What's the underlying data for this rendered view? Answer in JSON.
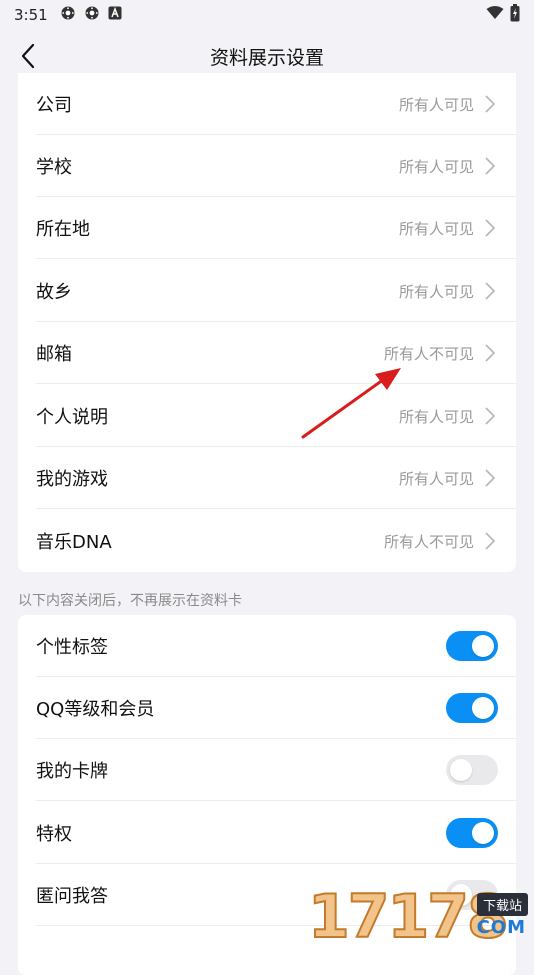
{
  "status_bar": {
    "time": "3:51",
    "icons": [
      "settings-gear-icon",
      "settings-gear-icon",
      "a-box-icon"
    ],
    "right_icons": [
      "wifi-icon",
      "battery-charging-icon"
    ]
  },
  "header": {
    "title": "资料展示设置",
    "back_icon": "chevron-left-icon"
  },
  "visibility_rows": [
    {
      "label": "公司",
      "value": "所有人可见"
    },
    {
      "label": "学校",
      "value": "所有人可见"
    },
    {
      "label": "所在地",
      "value": "所有人可见"
    },
    {
      "label": "故乡",
      "value": "所有人可见"
    },
    {
      "label": "邮箱",
      "value": "所有人不可见"
    },
    {
      "label": "个人说明",
      "value": "所有人可见"
    },
    {
      "label": "我的游戏",
      "value": "所有人可见"
    },
    {
      "label": "音乐DNA",
      "value": "所有人不可见"
    }
  ],
  "section_note": "以下内容关闭后，不再展示在资料卡",
  "toggle_rows": [
    {
      "label": "个性标签",
      "on": true
    },
    {
      "label": "QQ等级和会员",
      "on": true
    },
    {
      "label": "我的卡牌",
      "on": false
    },
    {
      "label": "特权",
      "on": true
    },
    {
      "label": "匿问我答",
      "on": false
    }
  ],
  "colors": {
    "toggle_on": "#0a90f5",
    "annotation_arrow": "#d91c1c",
    "background": "#f2f2f7"
  },
  "watermark": {
    "digits": "17178",
    "badge": "下载站",
    "domain": "COM"
  }
}
